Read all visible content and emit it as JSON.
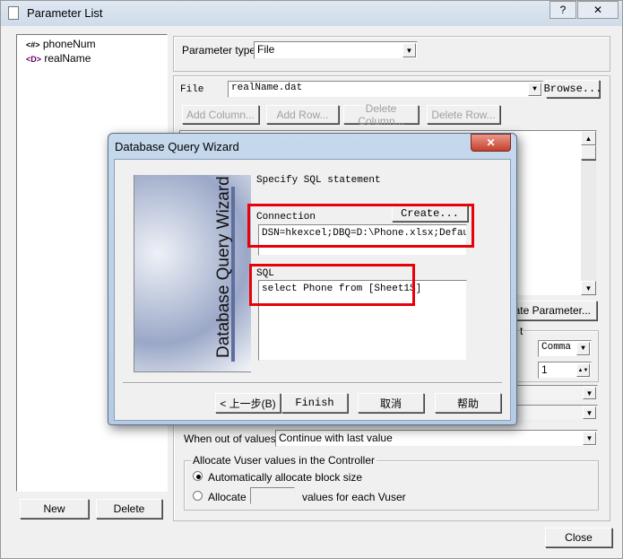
{
  "window": {
    "title": "Parameter List",
    "help_icon": "question-icon",
    "close_icon": "close-icon"
  },
  "tree": {
    "items": [
      {
        "icon": "<#>",
        "label": "phoneNum"
      },
      {
        "icon": "<D>",
        "label": "realName"
      }
    ]
  },
  "left_buttons": {
    "new": "New",
    "delete": "Delete"
  },
  "param_type": {
    "label": "Parameter type:",
    "value": "File"
  },
  "file": {
    "label": "File",
    "value": "realName.dat",
    "browse": "Browse..."
  },
  "table_buttons": [
    "Add Column...",
    "Add Row...",
    "Delete Column...",
    "Delete Row..."
  ],
  "simulate": "ulate Parameter...",
  "group_partial": "t",
  "delimiter": "Comma",
  "first_line": "1",
  "out_of_values": {
    "label": "When out of values:",
    "value": "Continue with last value"
  },
  "allocate": {
    "title": "Allocate Vuser values in the Controller",
    "auto": "Automatically allocate block size",
    "manual": "Allocate",
    "manual_suffix": "values for each Vuser",
    "auto_selected": true,
    "value": ""
  },
  "close_button": "Close",
  "wizard": {
    "title": "Database Query Wizard",
    "banner": "Database Query Wizard",
    "heading": "Specify SQL statement",
    "connection_label": "Connection",
    "create": "Create...",
    "connection": "DSN=hkexcel;DBQ=D:\\Phone.xlsx;DefaultD:",
    "sql_label": "SQL",
    "sql": "select Phone from [Sheet1$]",
    "buttons": {
      "back": "< 上一步(B)",
      "finish": "Finish",
      "cancel": "取消",
      "help": "帮助"
    },
    "highlight_color": "#e8000b"
  }
}
